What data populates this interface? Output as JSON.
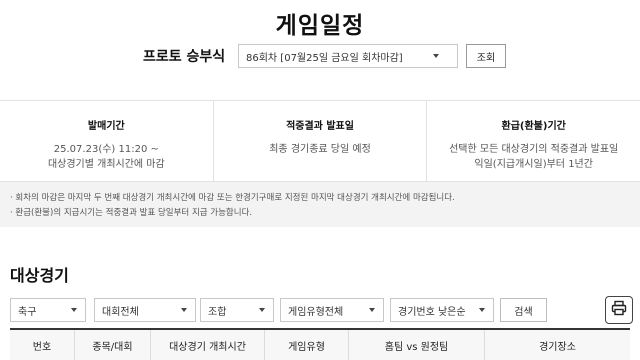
{
  "header": {
    "title": "게임일정"
  },
  "round_selector": {
    "label": "프로토 승부식",
    "selected": "86회차 [07월25일 금요일 회차마감]",
    "query_button": "조회"
  },
  "info": {
    "sale_period": {
      "title": "발매기간",
      "lines": [
        "25.07.23(수) 11:20 ~",
        "대상경기별 개최시간에 마감"
      ]
    },
    "result_announce": {
      "title": "적중결과 발표일",
      "lines": [
        "최종 경기종료 당일 예정"
      ]
    },
    "refund_period": {
      "title": "환급(환불)기간",
      "lines": [
        "선택한 모든 대상경기의 적중결과 발표일",
        "익일(지급개시일)부터 1년간"
      ]
    }
  },
  "notices": [
    "회차의 마감은 마지막 두 번째 대상경기 개최시간에 마감 또는 한경기구매로 지정된 마지막 대상경기 개최시간에 마감됩니다.",
    "환급(환불)의 지급시기는 적중결과 발표 당일부터 지급 가능합니다."
  ],
  "section": {
    "title": "대상경기"
  },
  "filters": {
    "sport": "축구",
    "league": "대회전체",
    "combo": "조합",
    "game_type": "게임유형전체",
    "sort": "경기번호 낮은순",
    "search_button": "검색"
  },
  "icons": {
    "print": "printer-icon",
    "dropdown": "chevron-down-icon"
  },
  "table": {
    "headers": [
      "번호",
      "종목/대회",
      "대상경기 개최시간",
      "게임유형",
      "홈팀 vs 원정팀",
      "경기장소"
    ]
  }
}
